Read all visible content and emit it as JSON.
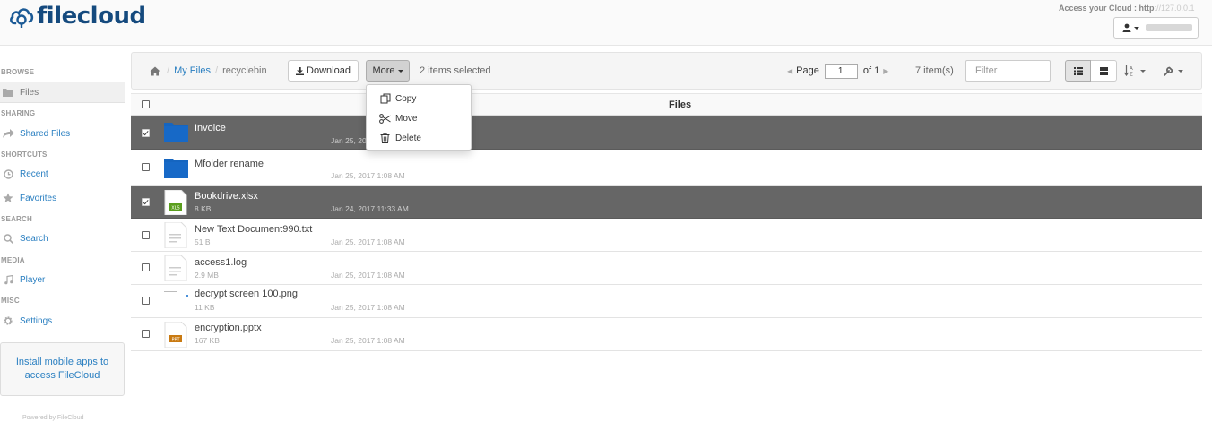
{
  "header": {
    "logo_text": "filecloud",
    "access_label": "Access your Cloud : http",
    "access_url_blurred": "://127.0.0.1",
    "user_name_hidden": ""
  },
  "sidebar": {
    "sections": {
      "browse": "BROWSE",
      "sharing": "SHARING",
      "shortcuts": "SHORTCUTS",
      "search": "SEARCH",
      "media": "MEDIA",
      "misc": "MISC"
    },
    "items": {
      "files": "Files",
      "shared_files": "Shared Files",
      "recent": "Recent",
      "favorites": "Favorites",
      "search": "Search",
      "player": "Player",
      "settings": "Settings"
    },
    "promo": "Install mobile apps to access FileCloud",
    "powered": "Powered by FileCloud"
  },
  "toolbar": {
    "breadcrumb": {
      "root": "My Files",
      "current": "recyclebin"
    },
    "download_label": "Download",
    "more_label": "More",
    "selection": "2 items selected",
    "page_label": "Page",
    "page_value": "1",
    "page_of": "of 1",
    "items_count": "7 item(s)",
    "filter_placeholder": "Filter"
  },
  "menu": {
    "copy": "Copy",
    "move": "Move",
    "delete": "Delete"
  },
  "table": {
    "header": "Files",
    "rows": [
      {
        "name": "Invoice",
        "size": "",
        "date": "Jan 25, 2017 1:08 AM",
        "type": "folder",
        "selected": true
      },
      {
        "name": "Mfolder rename",
        "size": "",
        "date": "Jan 25, 2017 1:08 AM",
        "type": "folder",
        "selected": false
      },
      {
        "name": "Bookdrive.xlsx",
        "size": "8 KB",
        "date": "Jan 24, 2017 11:33 AM",
        "type": "xls",
        "selected": true
      },
      {
        "name": "New Text Document990.txt",
        "size": "51 B",
        "date": "Jan 25, 2017 1:08 AM",
        "type": "txt",
        "selected": false
      },
      {
        "name": "access1.log",
        "size": "2.9 MB",
        "date": "Jan 25, 2017 1:08 AM",
        "type": "txt",
        "selected": false
      },
      {
        "name": "decrypt screen 100.png",
        "size": "11 KB",
        "date": "Jan 25, 2017 1:08 AM",
        "type": "png",
        "selected": false
      },
      {
        "name": "encryption.pptx",
        "size": "167 KB",
        "date": "Jan 25, 2017 1:08 AM",
        "type": "ppt",
        "selected": false
      }
    ],
    "icon_labels": {
      "xls": "XLS",
      "ppt": "PPT"
    }
  },
  "colors": {
    "accent": "#2a7fc1",
    "logo": "#1b5a96",
    "folder": "#1565c0",
    "selected_row": "#666666",
    "xls": "#5a9e1d",
    "ppt": "#c97a12"
  },
  "icons": {
    "logo": "cloud-logo-icon",
    "home": "home-icon",
    "download": "download-icon",
    "list_view": "list-view-icon",
    "grid_view": "grid-view-icon",
    "sort": "sort-icon",
    "wrench": "wrench-icon",
    "copy": "copy-icon",
    "move": "scissors-icon",
    "delete": "trash-icon"
  }
}
